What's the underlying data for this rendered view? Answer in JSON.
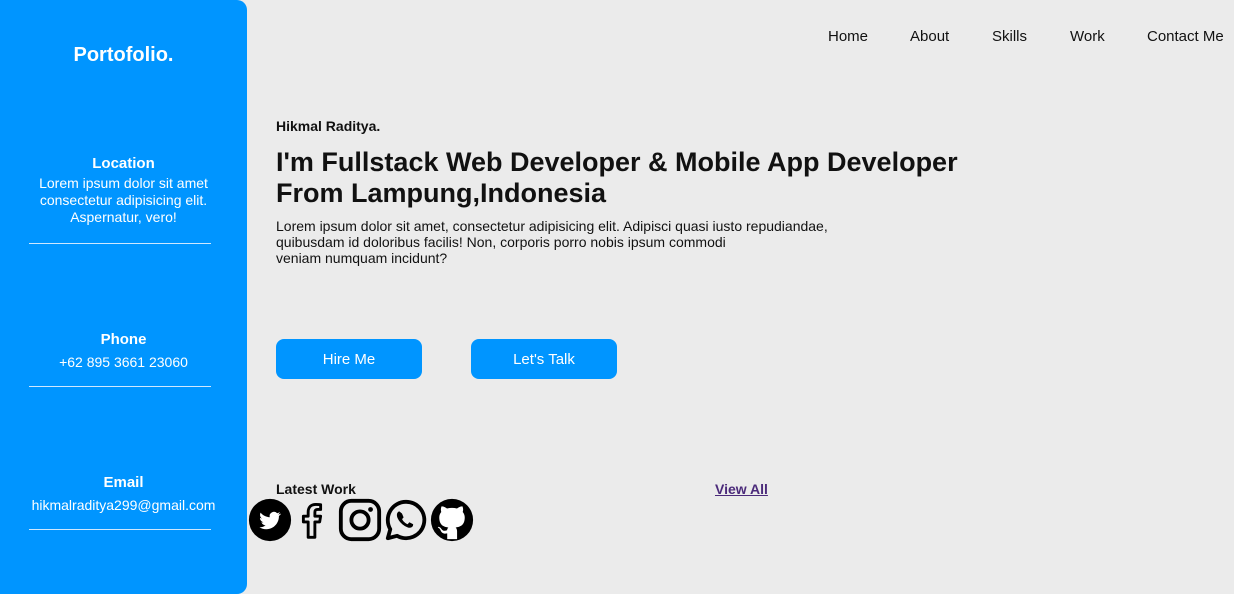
{
  "sidebar": {
    "brand": "Portofolio.",
    "location": {
      "title": "Location",
      "text": "Lorem ipsum dolor sit amet consectetur adipisicing elit. Aspernatur, vero!"
    },
    "phone": {
      "title": "Phone",
      "text": "+62 895 3661 23060"
    },
    "email": {
      "title": "Email",
      "text": "hikmalraditya299@gmail.com"
    }
  },
  "nav": {
    "items": [
      "Home",
      "About",
      "Skills",
      "Work",
      "Contact Me"
    ]
  },
  "hero": {
    "name": "Hikmal Raditya.",
    "headline": "I'm Fullstack Web Developer & Mobile App Developer From Lampung,Indonesia",
    "lead_lines": [
      "Lorem ipsum dolor sit amet, consectetur adipisicing elit. Adipisci quasi iusto repudiandae,",
      "quibusdam id doloribus facilis! Non, corporis porro nobis ipsum commodi",
      "veniam numquam incidunt?"
    ],
    "hire_label": "Hire Me",
    "talk_label": "Let's Talk"
  },
  "work": {
    "latest_label": "Latest Work",
    "view_all_label": "View All"
  },
  "socials": {
    "icons": [
      "twitter-icon",
      "facebook-icon",
      "instagram-icon",
      "whatsapp-icon",
      "github-icon"
    ]
  },
  "colors": {
    "accent": "#0095ff",
    "background": "#ebebeb",
    "link_visited": "#4b2a7a"
  }
}
